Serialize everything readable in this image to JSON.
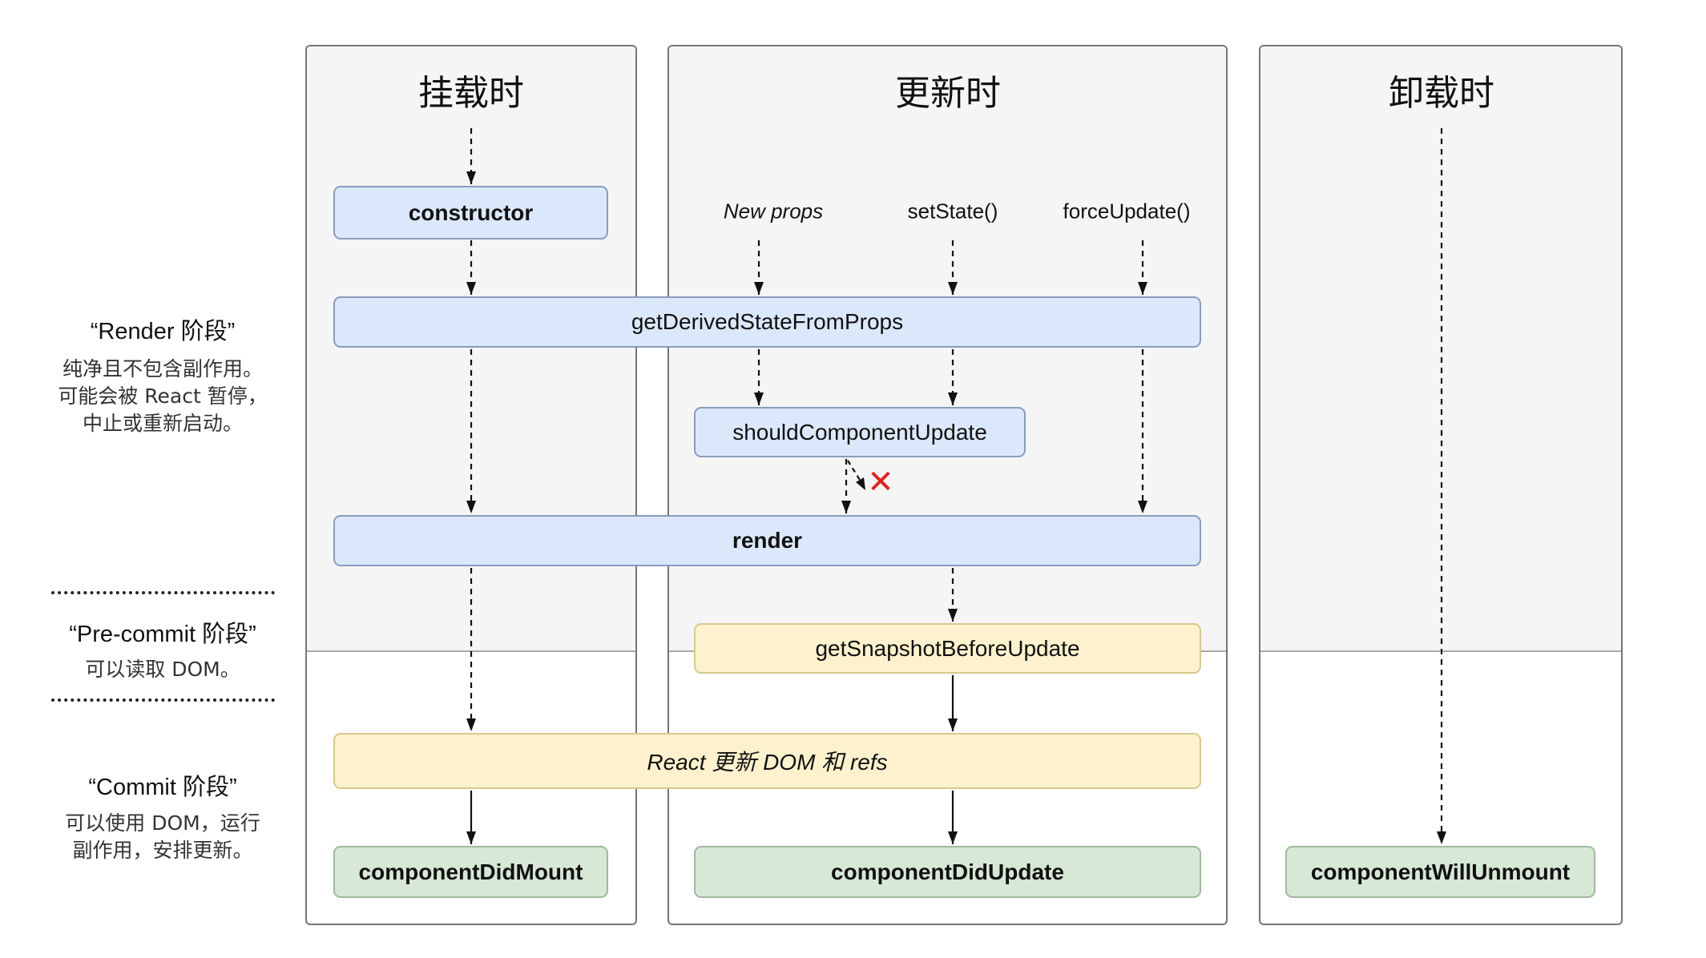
{
  "columns": [
    {
      "title": "挂载时"
    },
    {
      "title": "更新时"
    },
    {
      "title": "卸载时"
    }
  ],
  "triggers": [
    {
      "label": "New props",
      "italic": true
    },
    {
      "label": "setState()"
    },
    {
      "label": "forceUpdate()"
    }
  ],
  "methods": {
    "constructor": "constructor",
    "getDerivedStateFromProps": "getDerivedStateFromProps",
    "shouldComponentUpdate": "shouldComponentUpdate",
    "render": "render",
    "getSnapshotBeforeUpdate": "getSnapshotBeforeUpdate",
    "react_updates_dom": "React 更新 DOM 和 refs",
    "componentDidMount": "componentDidMount",
    "componentDidUpdate": "componentDidUpdate",
    "componentWillUnmount": "componentWillUnmount"
  },
  "phases": [
    {
      "title": "“Render 阶段”",
      "desc": [
        "纯净且不包含副作用。",
        "可能会被 React 暂停，",
        "中止或重新启动。"
      ]
    },
    {
      "title": "“Pre-commit 阶段”",
      "desc": [
        "可以读取 DOM。"
      ]
    },
    {
      "title": "“Commit 阶段”",
      "desc": [
        "可以使用 DOM，运行",
        "副作用，安排更新。"
      ]
    }
  ],
  "skip_marker": "✕",
  "colors": {
    "render_phase": "#dbe8fb",
    "precommit_phase": "#fdf2cd",
    "commit_phase": "#d7e8d6",
    "skip_marker": "#e02020"
  }
}
